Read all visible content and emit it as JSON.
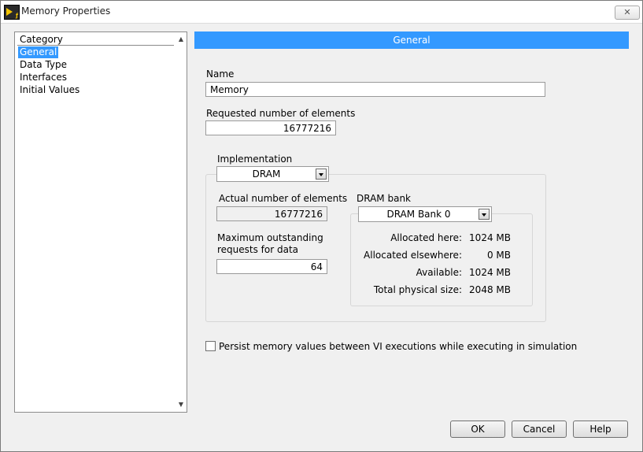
{
  "window": {
    "title": "Memory Properties",
    "close_label": "✕"
  },
  "category": {
    "header": "Category",
    "items": [
      "General",
      "Data Type",
      "Interfaces",
      "Initial Values"
    ],
    "selected_index": 0
  },
  "general": {
    "header": "General",
    "name_label": "Name",
    "name_value": "Memory",
    "requested_label": "Requested number of elements",
    "requested_value": "16777216",
    "implementation_label": "Implementation",
    "implementation_value": "DRAM",
    "actual_label": "Actual number of elements",
    "actual_value": "16777216",
    "max_requests_label_line1": "Maximum outstanding",
    "max_requests_label_line2": "requests for data",
    "max_requests_value": "64",
    "dram_bank_label": "DRAM bank",
    "dram_bank_value": "DRAM Bank 0",
    "stats": [
      {
        "label": "Allocated here:",
        "value": "1024 MB"
      },
      {
        "label": "Allocated elsewhere:",
        "value": "0 MB"
      },
      {
        "label": "Available:",
        "value": "1024 MB"
      },
      {
        "label": "Total physical size:",
        "value": "2048 MB"
      }
    ],
    "persist_label": "Persist memory values between VI executions while executing in simulation",
    "persist_checked": false
  },
  "buttons": {
    "ok": "OK",
    "cancel": "Cancel",
    "help": "Help"
  },
  "colors": {
    "accent": "#3399ff"
  }
}
